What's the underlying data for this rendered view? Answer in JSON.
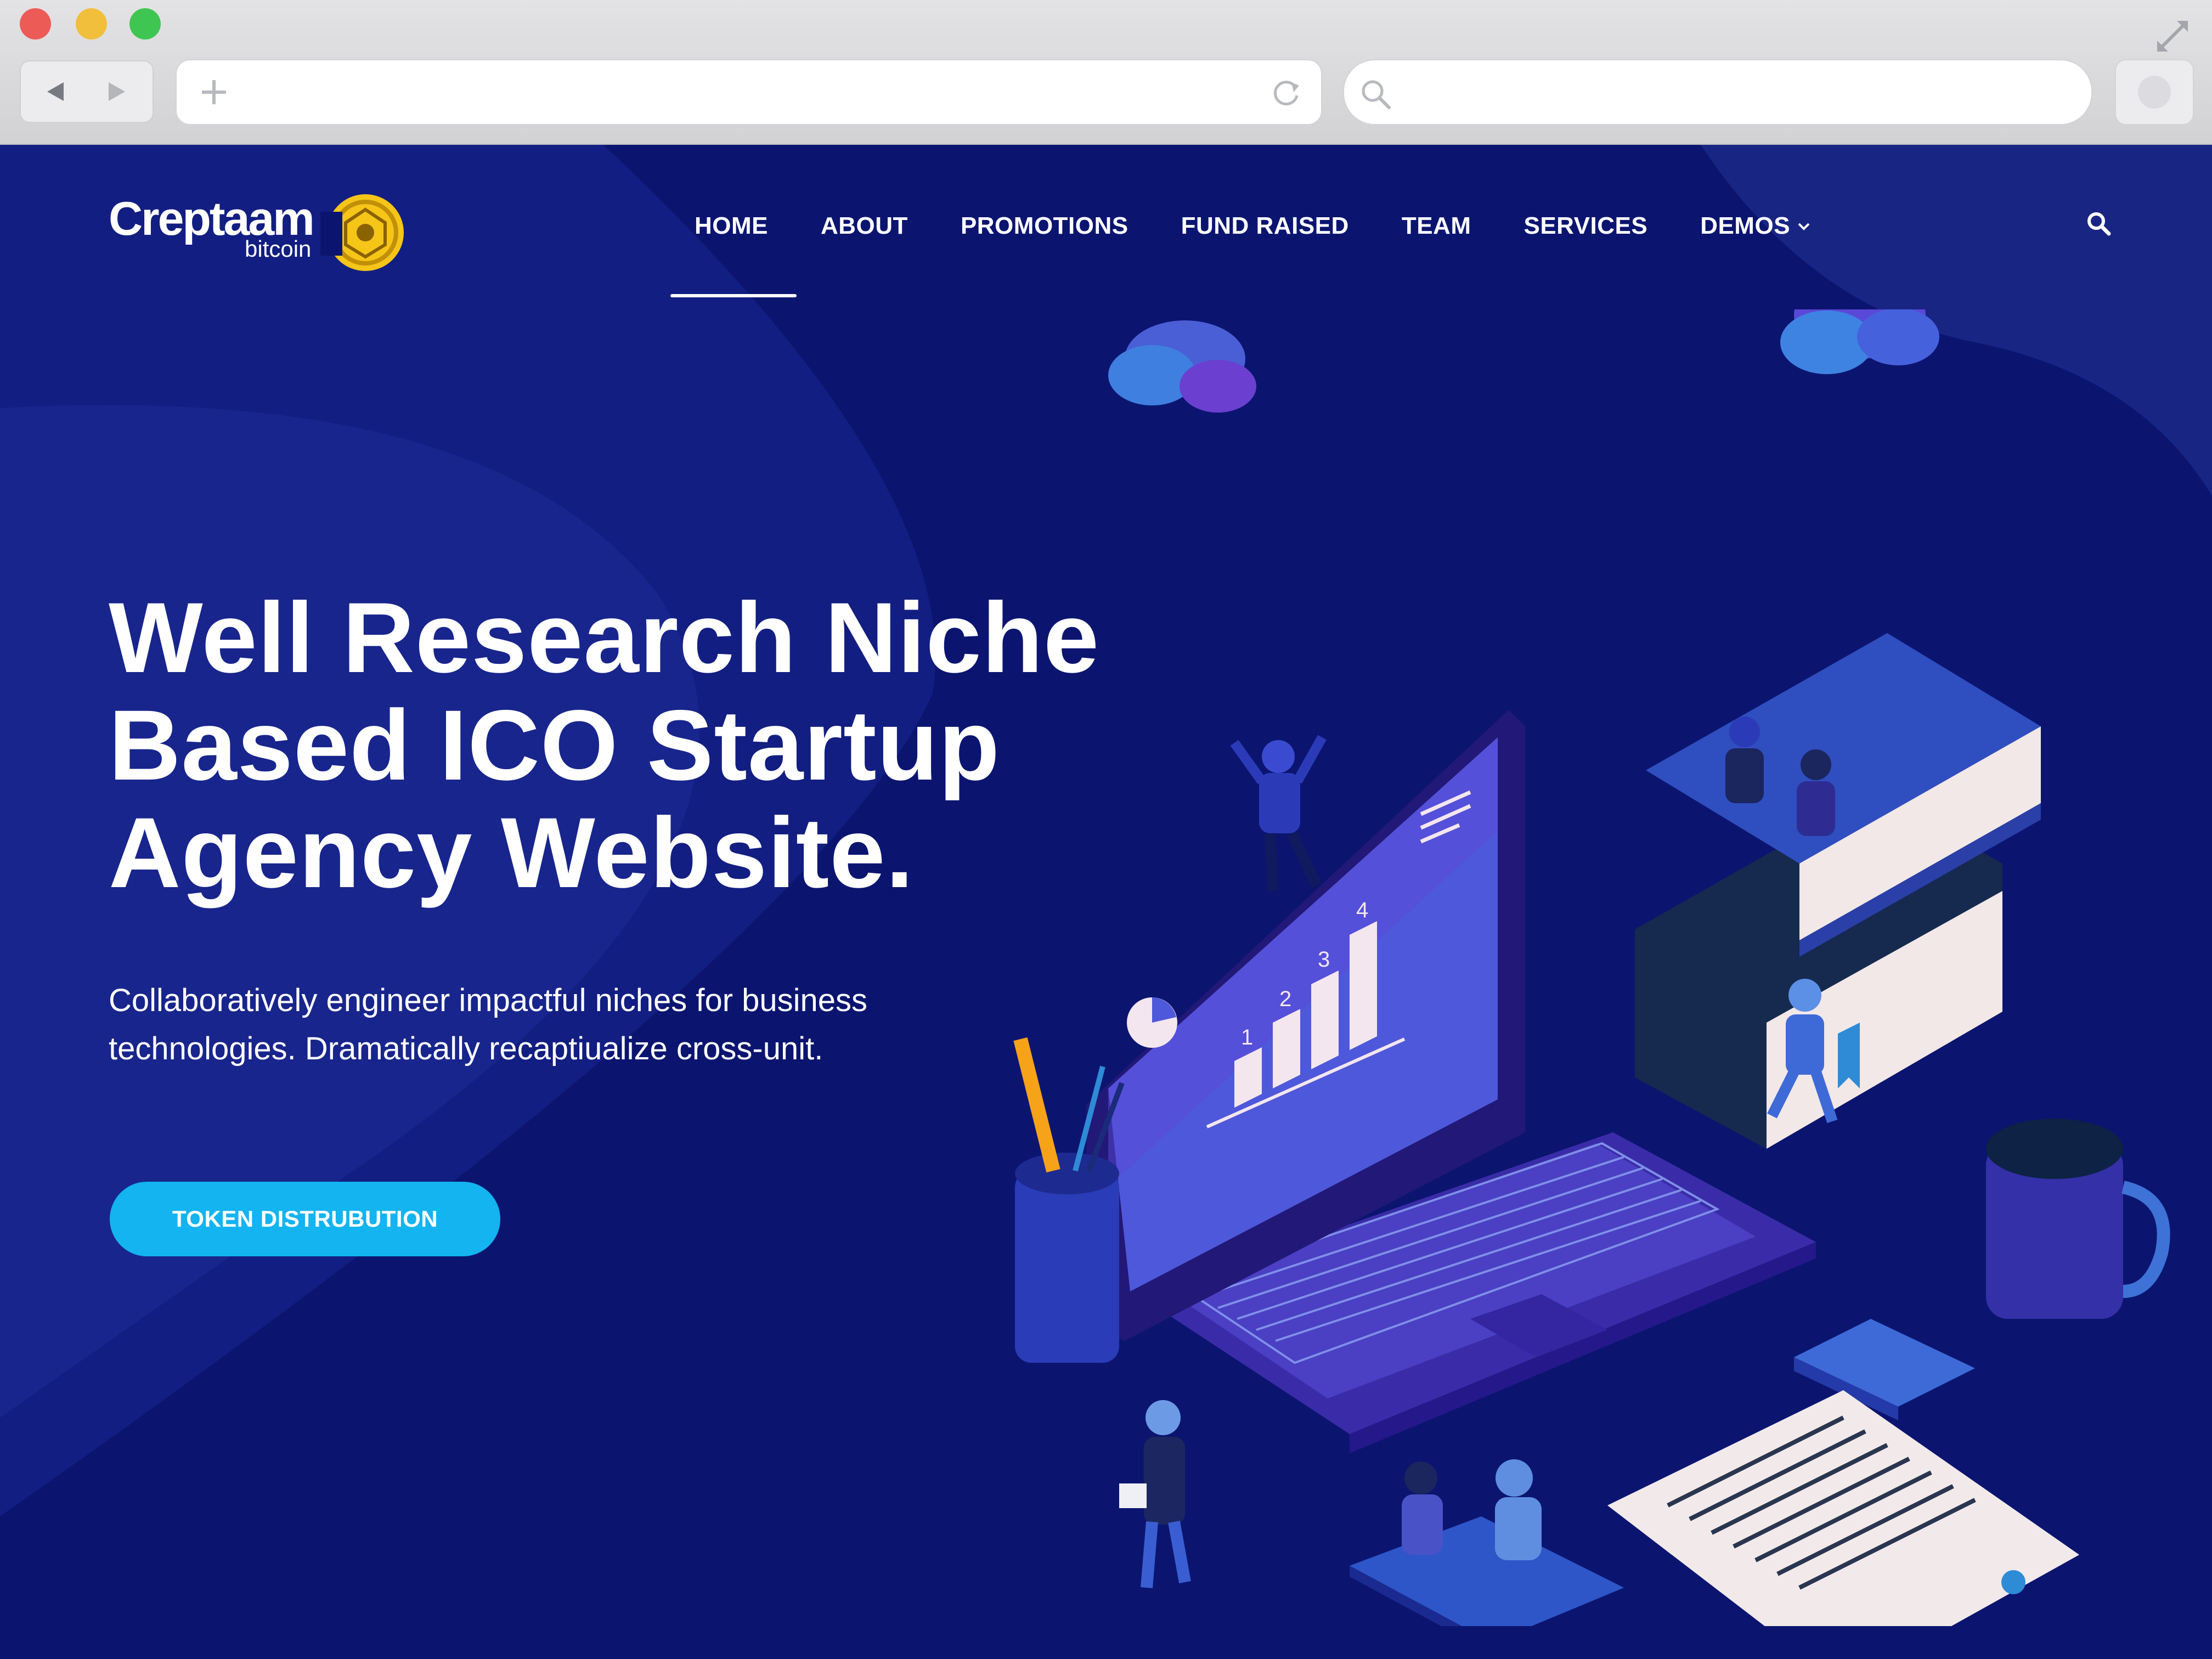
{
  "browser": {
    "controls": [
      "close",
      "minimize",
      "zoom"
    ],
    "icons": [
      "back-arrow-icon",
      "forward-arrow-icon",
      "plus-icon",
      "reload-icon",
      "search-icon",
      "expand-icon"
    ]
  },
  "site": {
    "logo": {
      "name": "Creptaam",
      "tagline": "bitcoin"
    },
    "nav": [
      {
        "label": "HOME",
        "active": true
      },
      {
        "label": "ABOUT"
      },
      {
        "label": "PROMOTIONS"
      },
      {
        "label": "FUND RAISED"
      },
      {
        "label": "TEAM"
      },
      {
        "label": "SERVICES"
      },
      {
        "label": "DEMOS"
      }
    ],
    "colors": {
      "background": "#0b1570",
      "accent": "#13b4ef",
      "text": "#ffffff"
    }
  },
  "hero": {
    "title_lines": [
      "Well Research Niche",
      "Based ICO Startup",
      "Agency Website."
    ],
    "description_lines": [
      "Collaboratively engineer impactful niches for business",
      "technologies. Dramatically recaptiualize cross-unit."
    ],
    "cta_label": "TOKEN DISTRUBUTION"
  },
  "illustration": {
    "chart_bar_labels": [
      "1",
      "2",
      "3",
      "4"
    ]
  }
}
